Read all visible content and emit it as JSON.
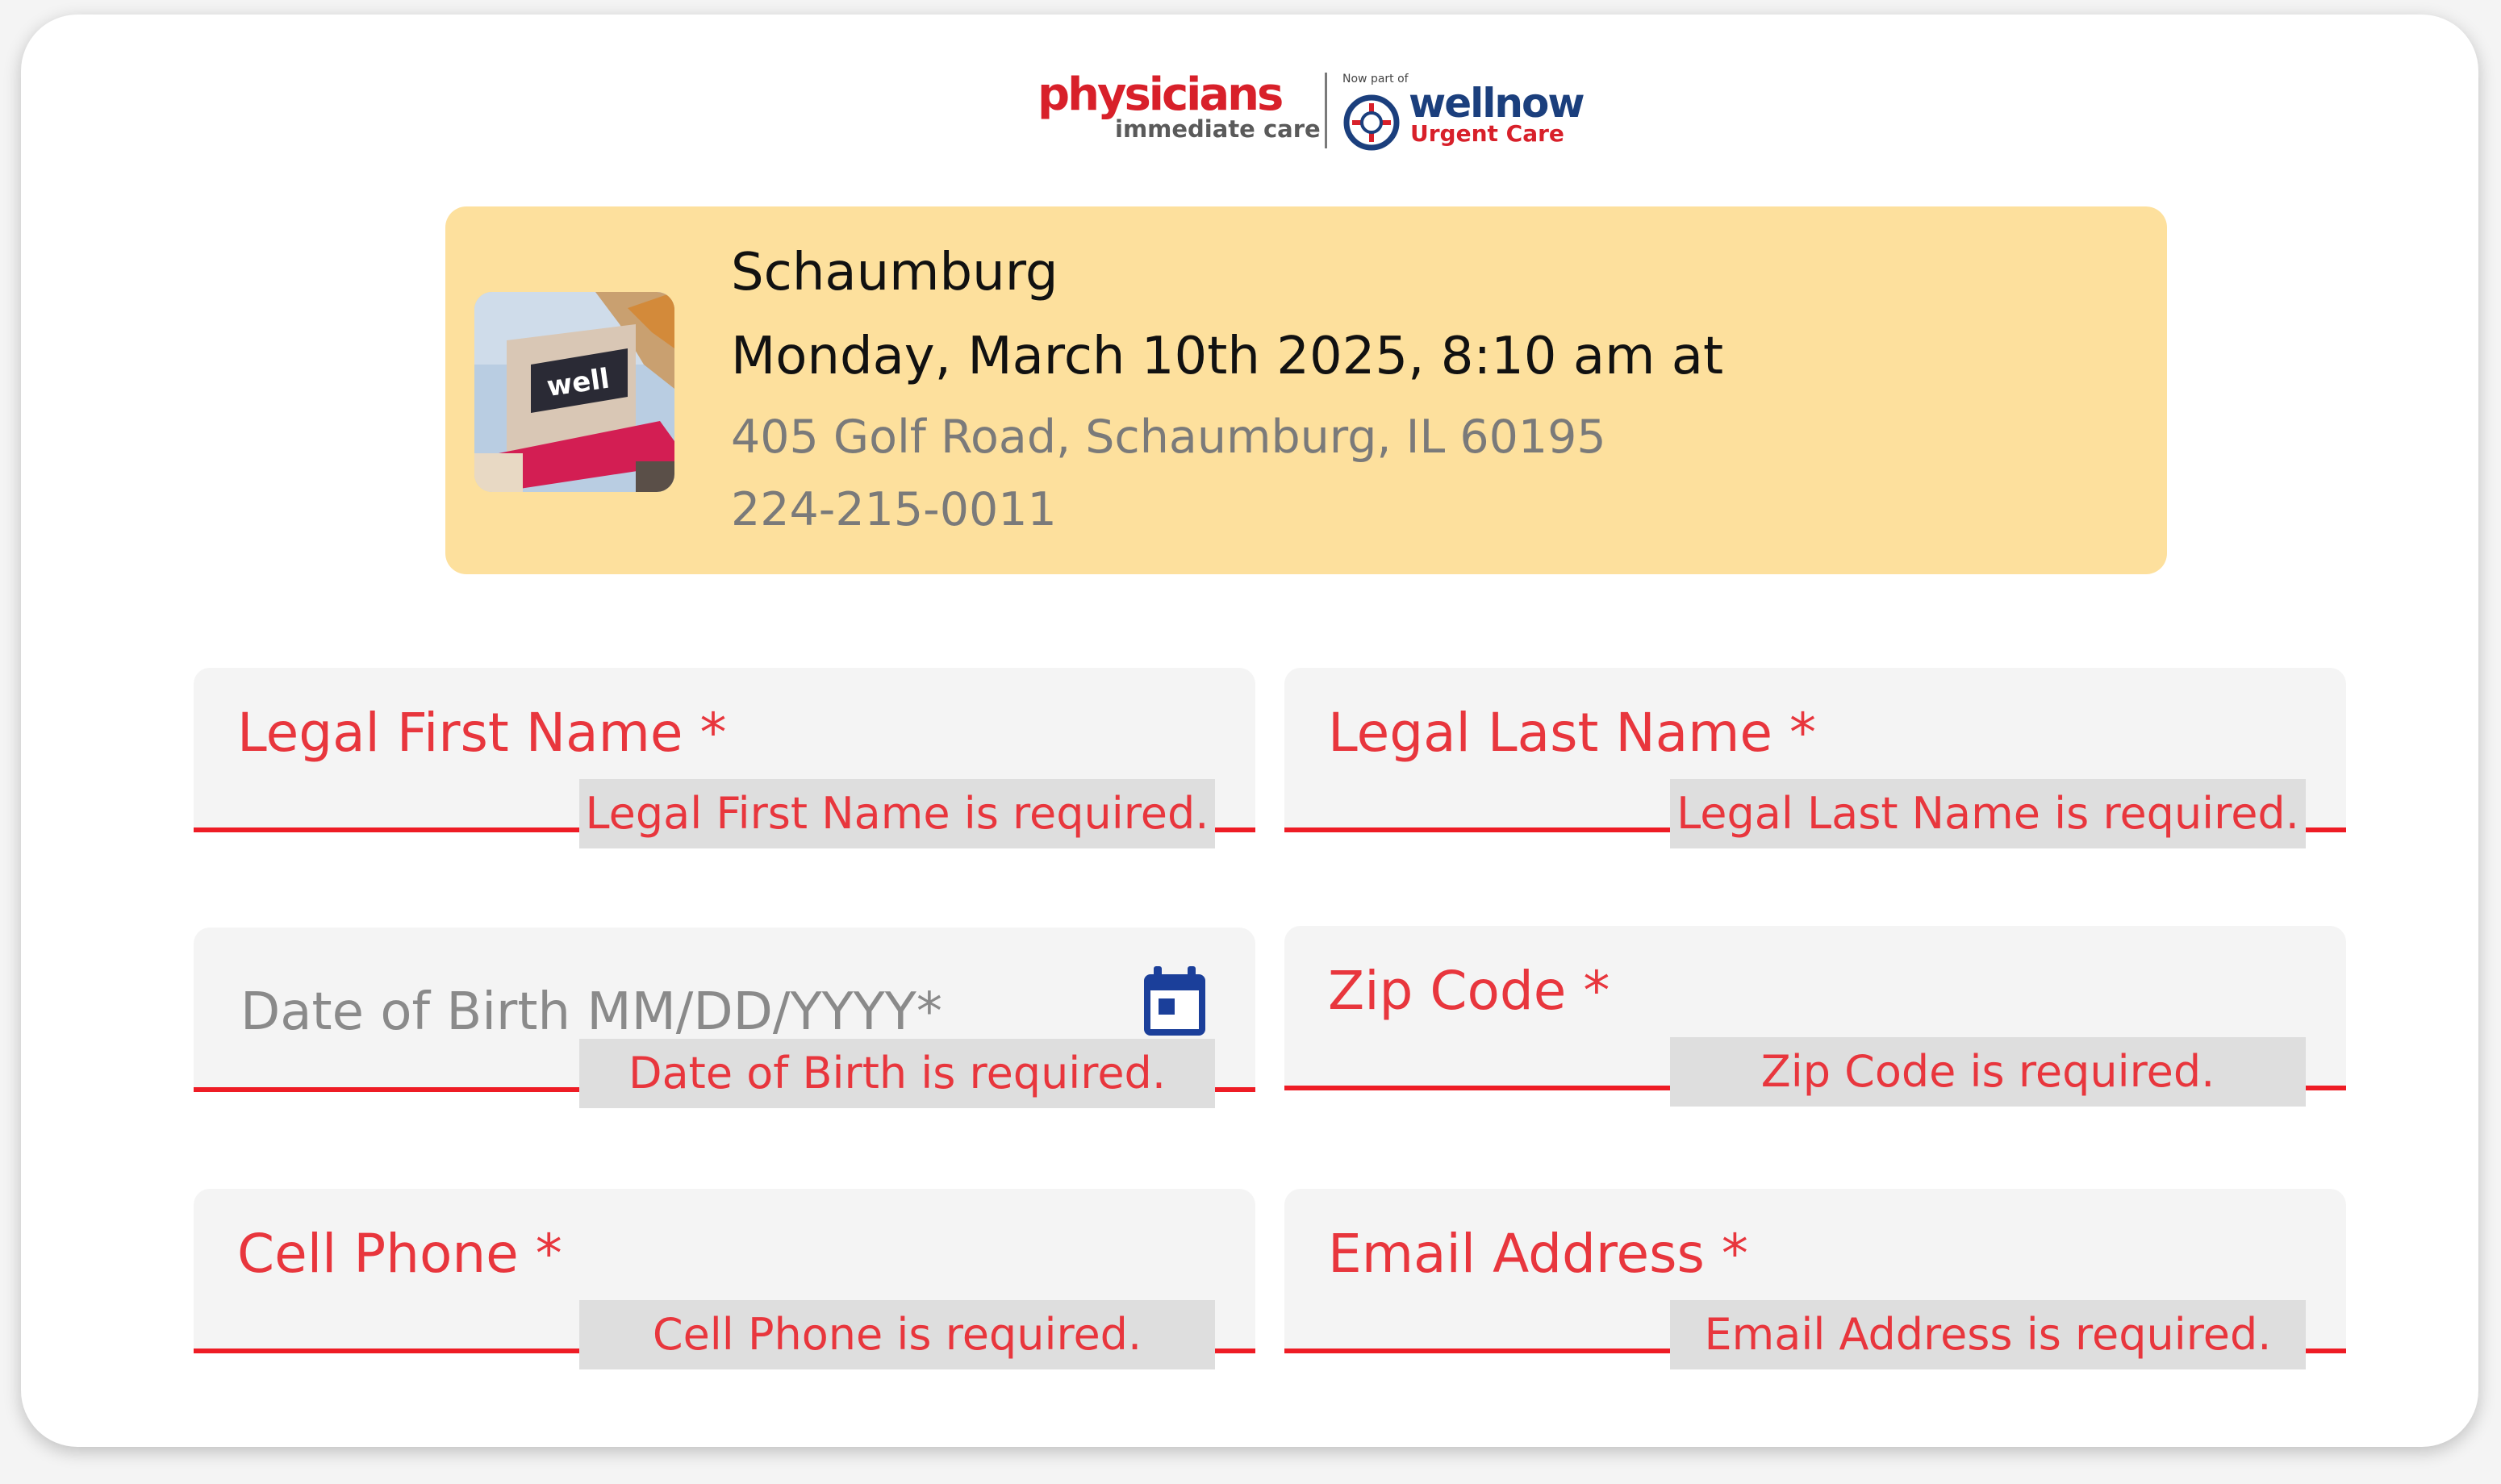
{
  "brand": {
    "physicians": "physicians",
    "immediate_care": "immediate care",
    "now_part_of": "Now part of",
    "wellnow": "wellnow",
    "urgent_care": "Urgent Care",
    "colors": {
      "red": "#d8202a",
      "navy": "#1b3f7d"
    }
  },
  "location": {
    "city": "Schaumburg",
    "datetime": "Monday, March 10th 2025, 8:10 am at",
    "address": "405 Golf Road, Schaumburg, IL 60195",
    "phone": "224-215-0011",
    "background": "#fde09d"
  },
  "form": {
    "first_name": {
      "label": "Legal First Name *",
      "error": "Legal First Name is required."
    },
    "last_name": {
      "label": "Legal Last Name *",
      "error": "Legal Last Name is required."
    },
    "dob": {
      "placeholder": "Date of Birth MM/DD/YYYY*",
      "error": "Date of Birth is required.",
      "icon": "calendar-icon"
    },
    "zip": {
      "label": "Zip Code *",
      "error": "Zip Code is required."
    },
    "cell_phone": {
      "label": "Cell Phone *",
      "error": "Cell Phone is required."
    },
    "email": {
      "label": "Email Address *",
      "error": "Email Address is required."
    },
    "error_color": "#ee1c25"
  }
}
